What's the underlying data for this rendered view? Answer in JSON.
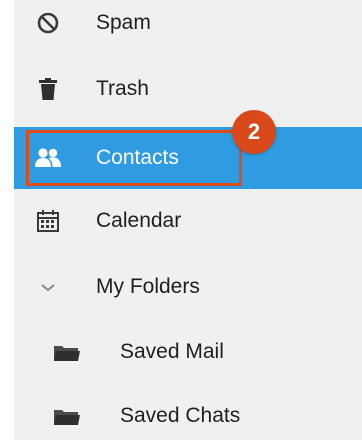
{
  "colors": {
    "selected_bg": "#2f9be0",
    "annotation": "#d9491a",
    "sidebar_bg": "#f0f0f0"
  },
  "sidebar": {
    "items": [
      {
        "label": "Spam",
        "icon": "block-icon"
      },
      {
        "label": "Trash",
        "icon": "trash-icon"
      },
      {
        "label": "Contacts",
        "icon": "contacts-icon",
        "selected": true
      },
      {
        "label": "Calendar",
        "icon": "calendar-icon"
      },
      {
        "label": "My Folders",
        "icon": "chevron-down-icon"
      },
      {
        "label": "Saved Mail",
        "icon": "folder-icon"
      },
      {
        "label": "Saved Chats",
        "icon": "folder-icon"
      }
    ]
  },
  "annotation": {
    "step_number": "2"
  }
}
